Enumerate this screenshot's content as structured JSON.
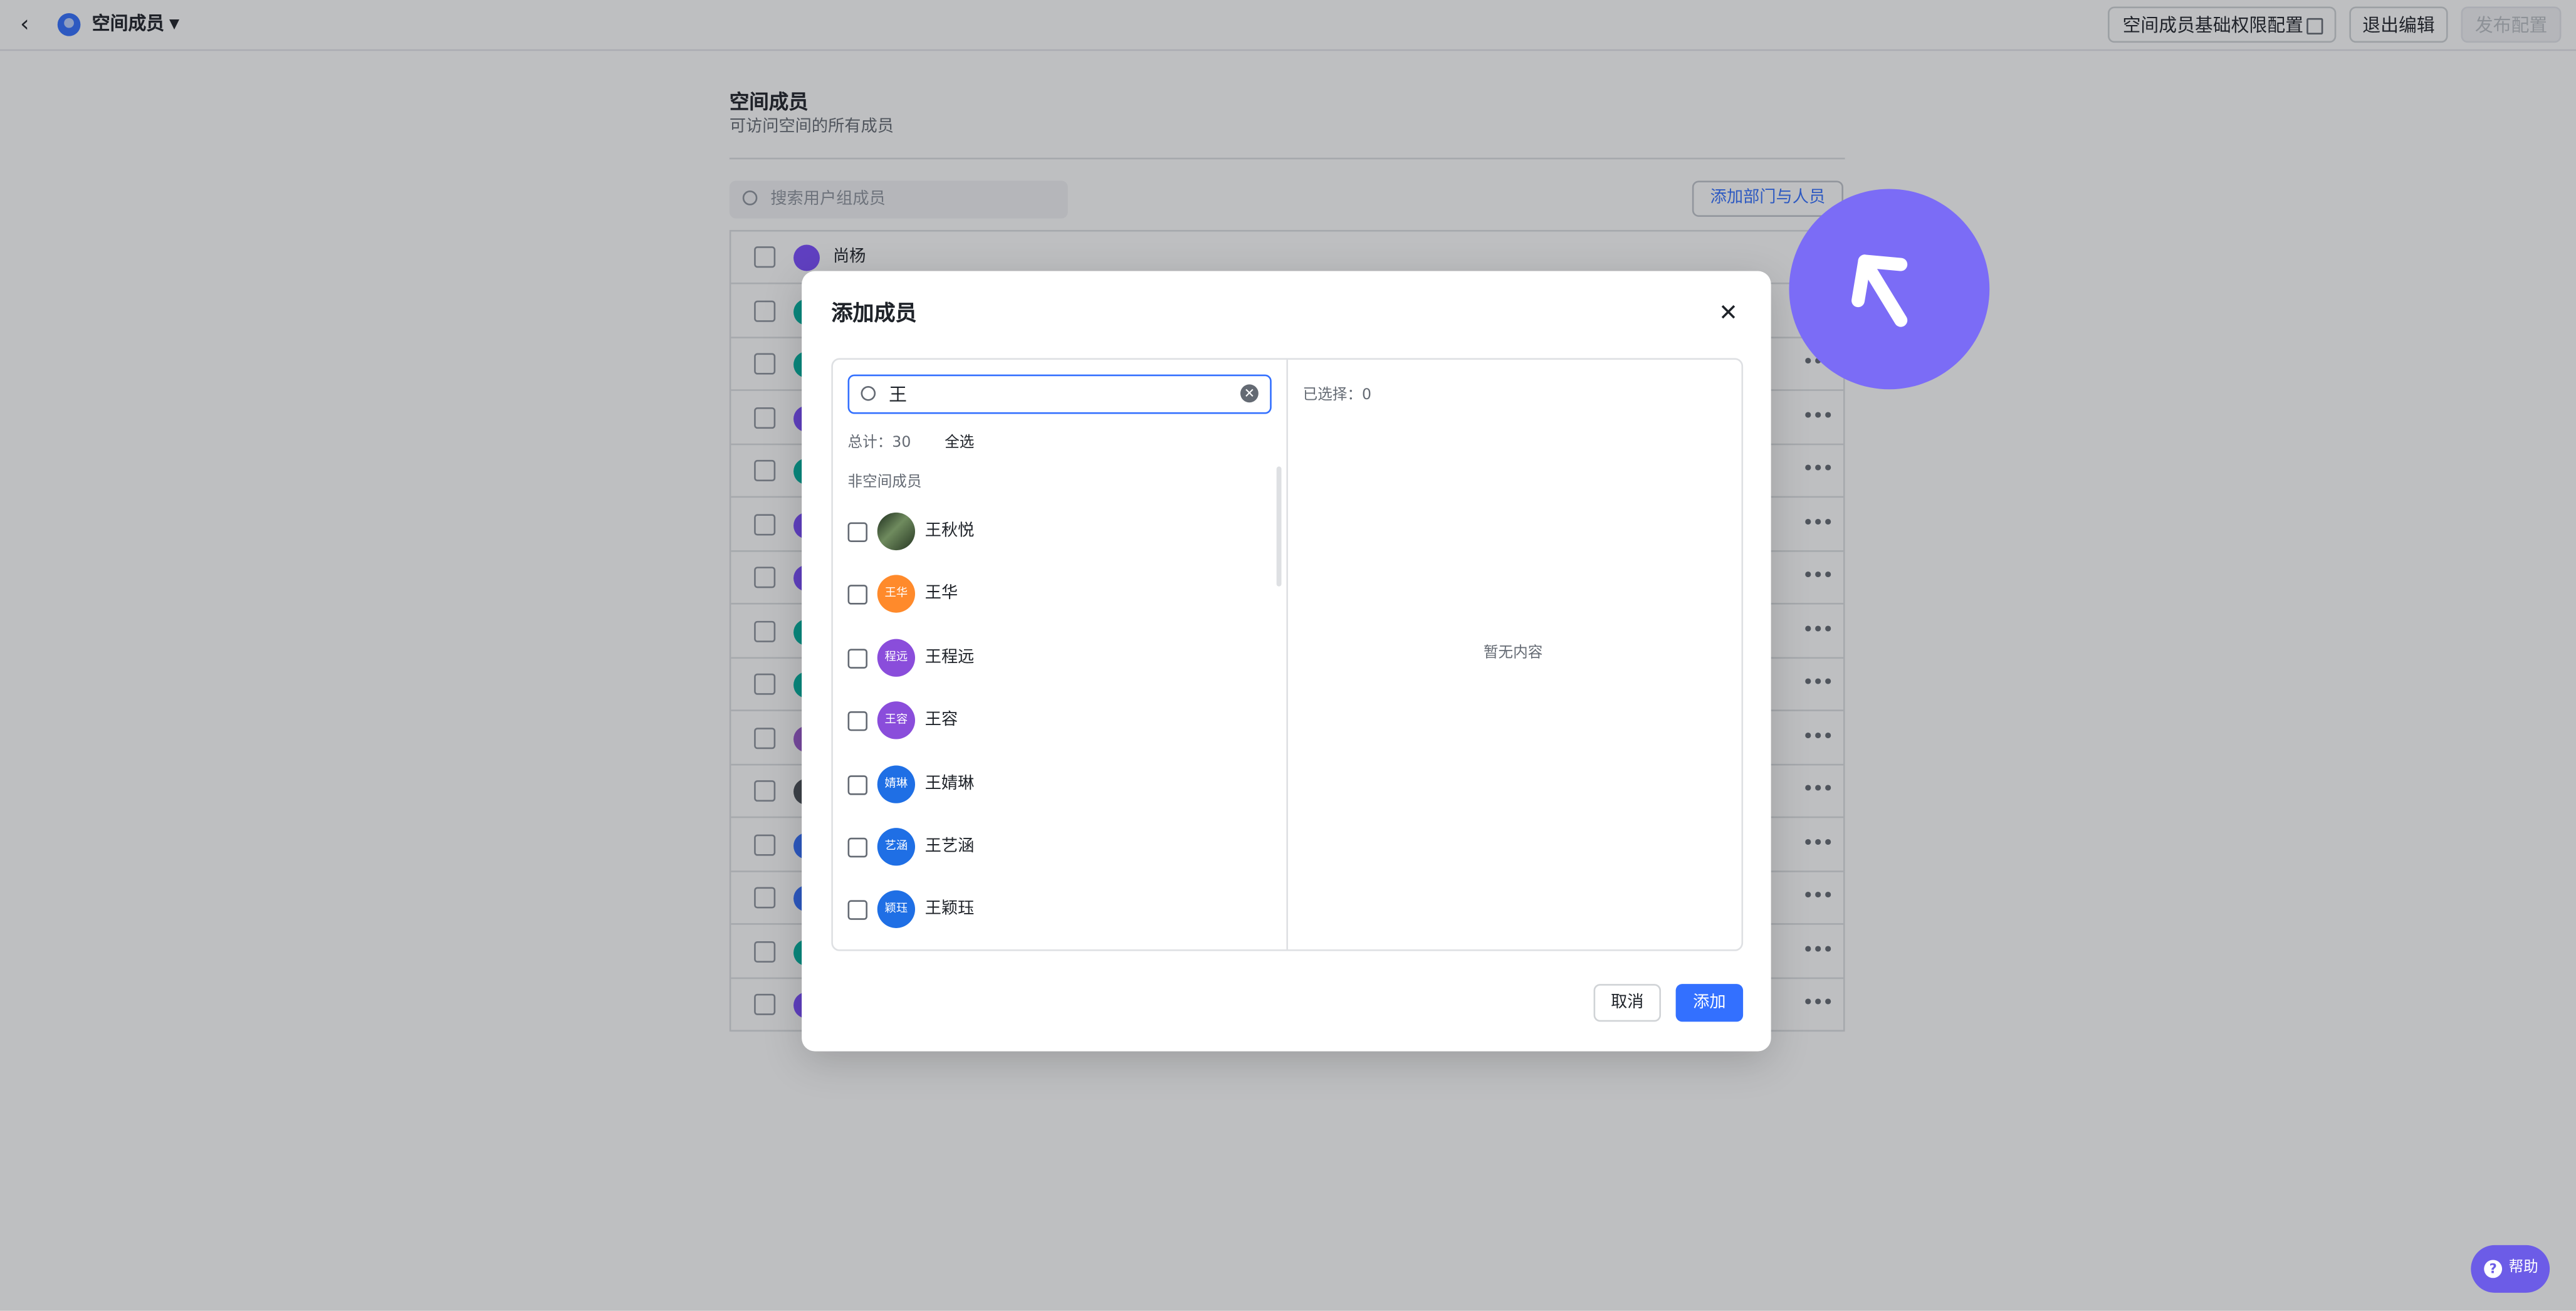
{
  "header": {
    "space_name": "空间成员",
    "permission_config_label": "空间成员基础权限配置",
    "exit_edit_label": "退出编辑",
    "publish_label": "发布配置"
  },
  "page": {
    "title": "空间成员",
    "subtitle": "可访问空间的所有成员",
    "search_placeholder": "搜索用户组成员",
    "add_dept_label": "添加部门与人员"
  },
  "table": {
    "first_member": "尚杨",
    "row_colors": [
      "#7b4dff",
      "#00b3a1",
      "#00b3a1",
      "#7b4dff",
      "#00b3a1",
      "#7b4dff",
      "#7b4dff",
      "#00b3a1",
      "#00b3a1",
      "#9b59d0",
      "#4a4f57",
      "#3370ff",
      "#3370ff",
      "#00b3a1",
      "#7b4dff"
    ]
  },
  "modal": {
    "title": "添加成员",
    "search_value": "王",
    "total_label": "总计：30",
    "select_all_label": "全选",
    "group_label": "非空间成员",
    "selected_label": "已选择：0",
    "empty_label": "暂无内容",
    "cancel_label": "取消",
    "add_label": "添加",
    "members": [
      {
        "name": "王秋悦",
        "avatar_text": "",
        "color": "#3d4a3a"
      },
      {
        "name": "王华",
        "avatar_text": "王华",
        "color": "#ff8a2b"
      },
      {
        "name": "王程远",
        "avatar_text": "程远",
        "color": "#8a4ddb"
      },
      {
        "name": "王容",
        "avatar_text": "王容",
        "color": "#8a4ddb"
      },
      {
        "name": "王婧琳",
        "avatar_text": "婧琳",
        "color": "#1f6fe5"
      },
      {
        "name": "王艺涵",
        "avatar_text": "艺涵",
        "color": "#1f6fe5"
      },
      {
        "name": "王颖珏",
        "avatar_text": "颖珏",
        "color": "#1f6fe5"
      }
    ]
  },
  "help": {
    "label": "帮助"
  }
}
